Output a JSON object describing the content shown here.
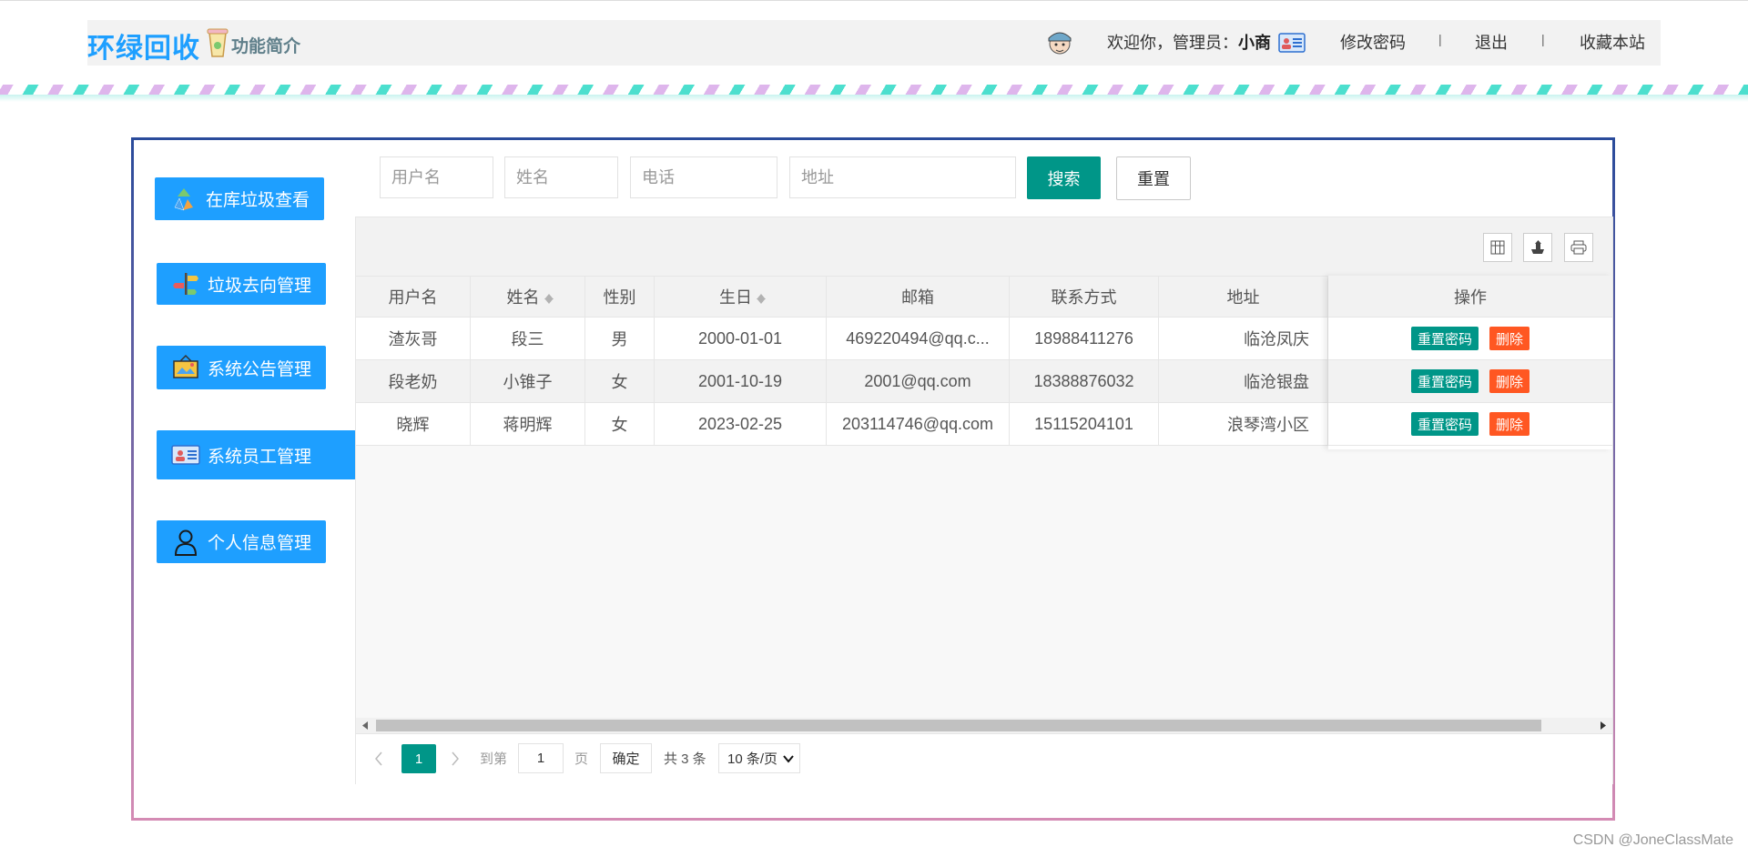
{
  "header": {
    "brand": "环绿回收",
    "intro": "功能简介",
    "welcome_prefix": "欢迎你，管理员：",
    "username": "小商",
    "links": {
      "change_password": "修改密码",
      "logout": "退出",
      "bookmark": "收藏本站"
    },
    "separator": "|"
  },
  "sidebar": {
    "items": [
      {
        "label": "在库垃圾查看",
        "icon": "recycle-icon"
      },
      {
        "label": "垃圾去向管理",
        "icon": "signpost-icon"
      },
      {
        "label": "系统公告管理",
        "icon": "announcement-board-icon"
      },
      {
        "label": "系统员工管理",
        "icon": "id-card-icon"
      },
      {
        "label": "个人信息管理",
        "icon": "person-icon"
      }
    ]
  },
  "search": {
    "username_placeholder": "用户名",
    "name_placeholder": "姓名",
    "phone_placeholder": "电话",
    "address_placeholder": "地址",
    "search_label": "搜索",
    "reset_label": "重置"
  },
  "table": {
    "columns": [
      "用户名",
      "姓名",
      "性别",
      "生日",
      "邮箱",
      "联系方式",
      "地址",
      "操作"
    ],
    "rows": [
      {
        "username": "渣灰哥",
        "name": "段三",
        "gender": "男",
        "birthday": "2000-01-01",
        "email": "469220494@qq.c...",
        "phone": "18988411276",
        "address": "临沧凤庆"
      },
      {
        "username": "段老奶",
        "name": "小锥子",
        "gender": "女",
        "birthday": "2001-10-19",
        "email": "2001@qq.com",
        "phone": "18388876032",
        "address": "临沧银盘"
      },
      {
        "username": "晓辉",
        "name": "蒋明辉",
        "gender": "女",
        "birthday": "2023-02-25",
        "email": "203114746@qq.com",
        "phone": "15115204101",
        "address": "浪琴湾小区"
      }
    ],
    "actions": {
      "reset_password": "重置密码",
      "delete": "删除"
    }
  },
  "pagination": {
    "current_page": "1",
    "goto_label": "到第",
    "goto_value": "1",
    "page_unit": "页",
    "confirm": "确定",
    "total": "共 3 条",
    "page_size": "10 条/页"
  },
  "watermark": "CSDN @JoneClassMate",
  "colors": {
    "primary": "#1e9fff",
    "teal": "#009688",
    "danger": "#ff5722"
  }
}
